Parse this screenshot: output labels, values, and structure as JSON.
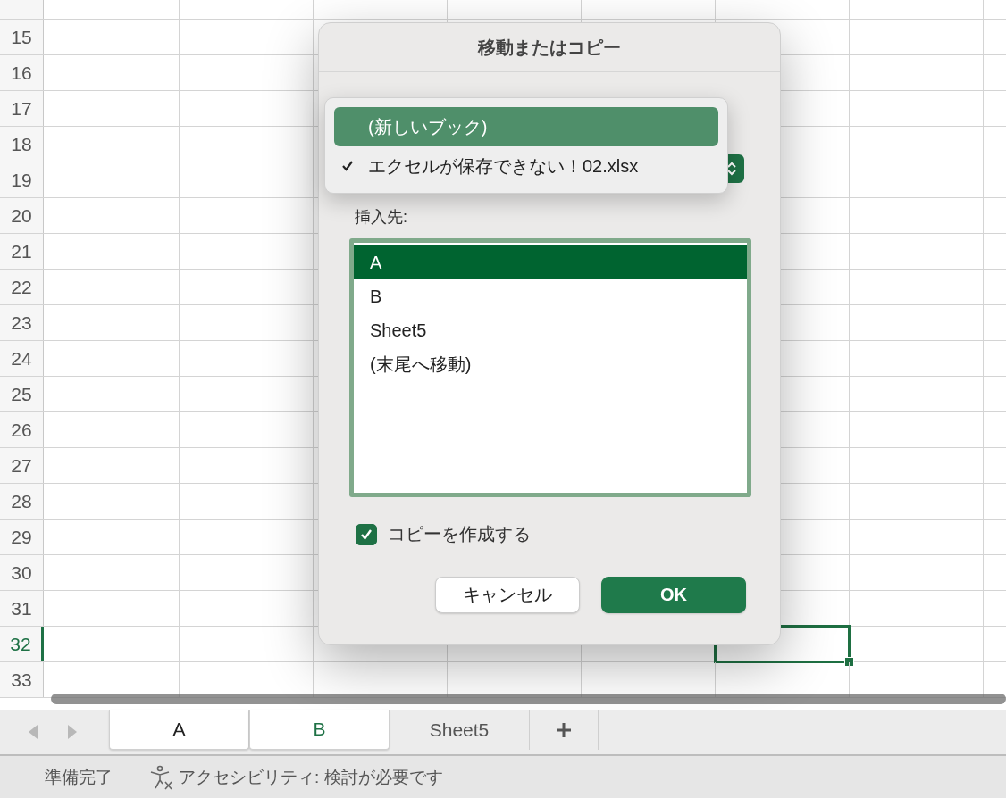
{
  "sheet": {
    "rows": [
      {
        "label": "15",
        "selected": false
      },
      {
        "label": "16",
        "selected": false
      },
      {
        "label": "17",
        "selected": false
      },
      {
        "label": "18",
        "selected": false
      },
      {
        "label": "19",
        "selected": false
      },
      {
        "label": "20",
        "selected": false
      },
      {
        "label": "21",
        "selected": false
      },
      {
        "label": "22",
        "selected": false
      },
      {
        "label": "23",
        "selected": false
      },
      {
        "label": "24",
        "selected": false
      },
      {
        "label": "25",
        "selected": false
      },
      {
        "label": "26",
        "selected": false
      },
      {
        "label": "27",
        "selected": false
      },
      {
        "label": "28",
        "selected": false
      },
      {
        "label": "29",
        "selected": false
      },
      {
        "label": "30",
        "selected": false
      },
      {
        "label": "31",
        "selected": false
      },
      {
        "label": "32",
        "selected": true
      },
      {
        "label": "33",
        "selected": false
      }
    ]
  },
  "dialog": {
    "title": "移動またはコピー",
    "book_menu": [
      {
        "label": "(新しいブック)",
        "checked": false,
        "selected": true
      },
      {
        "label": "エクセルが保存できない！02.xlsx",
        "checked": true,
        "selected": false
      }
    ],
    "insert_label": "挿入先:",
    "insert_list": [
      {
        "label": "A",
        "selected": true
      },
      {
        "label": "B",
        "selected": false
      },
      {
        "label": "Sheet5",
        "selected": false
      },
      {
        "label": "(末尾へ移動)",
        "selected": false
      }
    ],
    "copy_checkbox": {
      "label": "コピーを作成する",
      "checked": true
    },
    "buttons": [
      {
        "label": "キャンセル",
        "kind": "normal"
      },
      {
        "label": "OK",
        "kind": "default"
      }
    ]
  },
  "sheet_tabs": [
    {
      "label": "A",
      "selected": true,
      "active": false
    },
    {
      "label": "B",
      "selected": true,
      "active": true
    },
    {
      "label": "Sheet5",
      "selected": false,
      "active": false
    }
  ],
  "status_bar": {
    "status": "準備完了",
    "accessibility": "アクセシビリティ: 検討が必要です"
  }
}
